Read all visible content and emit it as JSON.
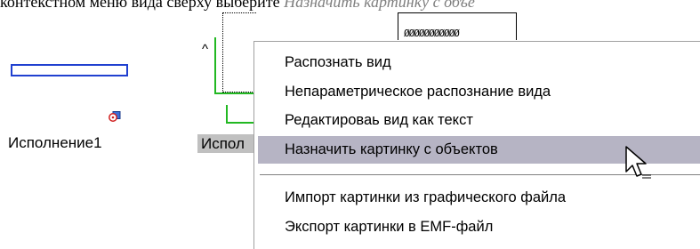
{
  "caption": {
    "text": "контекстном меню вида сверху выберите ",
    "highlight": "Назначить картинку с объе"
  },
  "views": {
    "left_view_label": "Исполнение1",
    "selected_view_label": "Испол"
  },
  "context_menu": {
    "items": [
      {
        "label": "Распознать вид",
        "active": false
      },
      {
        "label": "Непараметрическое распознание вида",
        "active": false
      },
      {
        "label": "Редактироваь вид как текст",
        "active": false
      },
      {
        "label": "Назначить картинку с объектов",
        "active": true
      },
      {
        "label": "Импорт картинки из графического файла",
        "active": false
      },
      {
        "label": "Экспорт картинки в EMF-файл",
        "active": false
      }
    ]
  },
  "colors": {
    "menu_highlight": "#b6b4c4",
    "view_frame": "#2040d0",
    "green_lines": "#22b822",
    "view_selection": "#c0c0c0"
  },
  "icons": {
    "view_badge": "view-link-icon",
    "cursor": "arrow-cursor-icon"
  }
}
